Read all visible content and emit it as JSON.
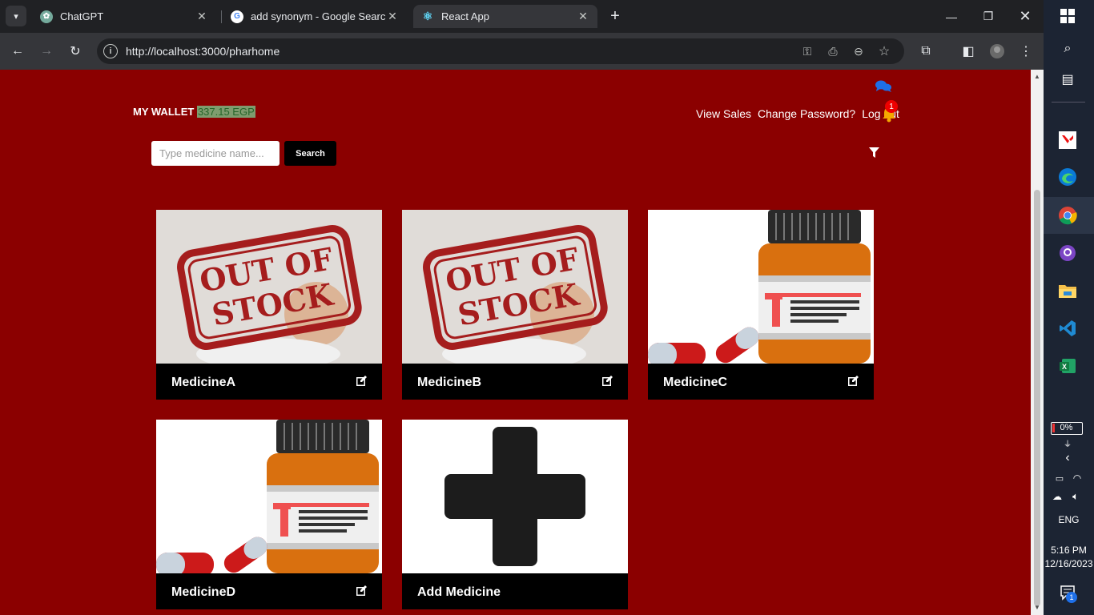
{
  "browser": {
    "tabs": [
      {
        "title": "ChatGPT",
        "icon": "chatgpt-icon"
      },
      {
        "title": "add synonym - Google Search",
        "icon": "google-icon"
      },
      {
        "title": "React App",
        "icon": "react-icon"
      }
    ],
    "url": "http://localhost:3000/pharhome"
  },
  "header": {
    "wallet_label": "MY WALLET",
    "wallet_amount": "337.15 EGP",
    "nav": {
      "view_sales": "View Sales",
      "change_password": "Change Password?",
      "log_out": "Log out"
    },
    "notification_count": "1"
  },
  "search": {
    "placeholder": "Type medicine name...",
    "button_label": "Search"
  },
  "cards": [
    {
      "name": "MedicineA",
      "image": "out-of-stock"
    },
    {
      "name": "MedicineB",
      "image": "out-of-stock"
    },
    {
      "name": "MedicineC",
      "image": "medicine-bottle"
    },
    {
      "name": "MedicineD",
      "image": "medicine-bottle"
    },
    {
      "name": "Add Medicine",
      "image": "plus"
    }
  ],
  "stamp": {
    "line1": "OUT OF",
    "line2": "STOCK"
  },
  "taskbar": {
    "battery": "0%",
    "language": "ENG",
    "time": "5:16 PM",
    "date": "12/16/2023",
    "notification_badge": "1"
  },
  "colors": {
    "page_bg": "#8b0000",
    "card_bar": "#000000",
    "wallet_highlight": "#7e9c6e"
  }
}
